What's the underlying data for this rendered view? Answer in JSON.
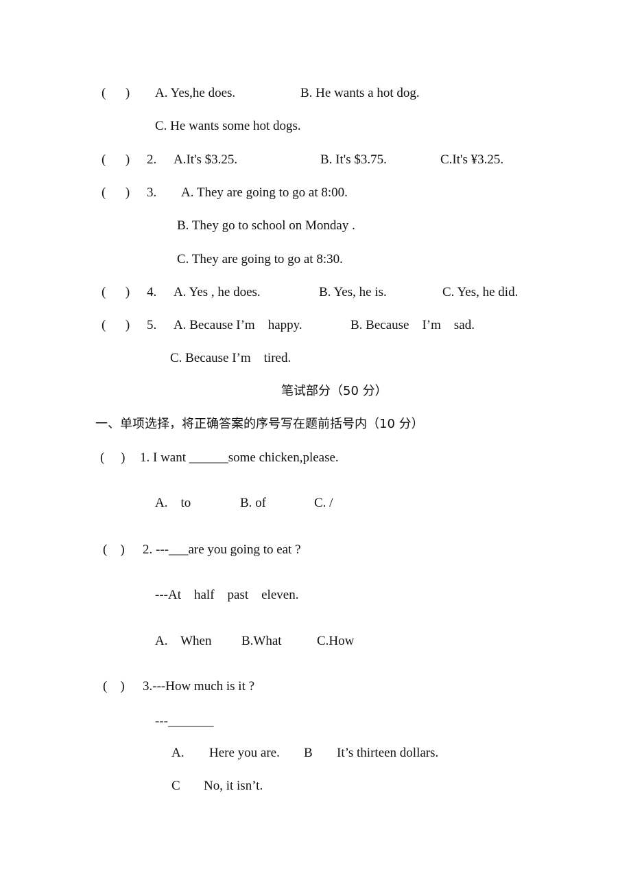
{
  "listening": {
    "q1": {
      "bracket": "(      )",
      "a": "A. Yes,he does.",
      "b": "B. He wants a hot dog.",
      "c": "C. He wants some hot dogs."
    },
    "q2": {
      "bracket": "(      )",
      "num": "2.",
      "a": "A.It's $3.25.",
      "b": "B. It's $3.75.",
      "c": "C.It's ¥3.25."
    },
    "q3": {
      "bracket": "(      )",
      "num": "3.",
      "a": "A. They are going to go at 8:00.",
      "b": "B. They go to school on Monday .",
      "c": "C. They are going to go at 8:30."
    },
    "q4": {
      "bracket": "(      )",
      "num": "4.",
      "a": "A. Yes , he does.",
      "b": "B. Yes, he is.",
      "c": "C. Yes, he did."
    },
    "q5": {
      "bracket": "(      )",
      "num": "5.",
      "a": "A. Because I’m    happy.",
      "b": "B. Because    I’m    sad.",
      "c": "C. Because I’m    tired."
    }
  },
  "written": {
    "title": "笔试部分（50 分）",
    "section1_heading": "一、单项选择，将正确答案的序号写在题前括号内（10 分）",
    "q1": {
      "bracket": "(     )",
      "stem": "1. I want ______some chicken,please.",
      "a": "A.    to",
      "b": "B. of",
      "c": "C. /"
    },
    "q2": {
      "bracket": "(    )",
      "stem": "2. ---___are you going to eat ?",
      "answer_line": "---At    half    past    eleven.",
      "a": "A.    When",
      "b": "B.What",
      "c": "C.How"
    },
    "q3": {
      "bracket": "(    )",
      "stem": "3.---How much is it ?",
      "answer_line": "---_______",
      "a_label": "A.",
      "a": "Here you are.",
      "b_label": "B",
      "b": "It’s thirteen dollars.",
      "c_label": "C",
      "c": "No, it isn’t."
    }
  }
}
